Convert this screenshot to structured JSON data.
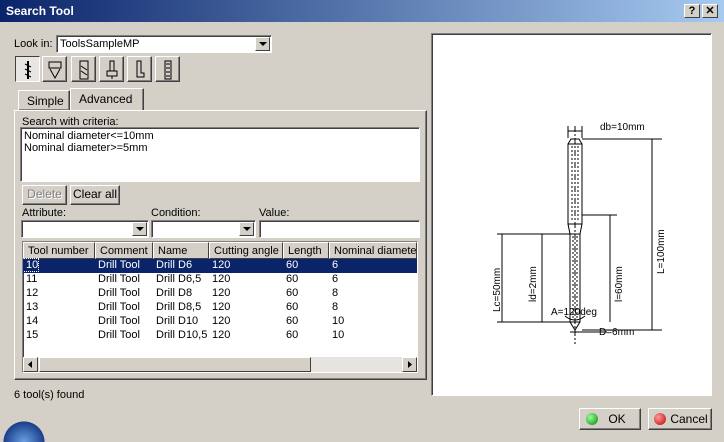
{
  "window": {
    "title": "Search Tool",
    "help_label": "?",
    "close_label": "✕"
  },
  "look_in": {
    "label": "Look in:",
    "value": "ToolsSampleMP"
  },
  "tool_types": [
    "drill-icon",
    "countersink-icon",
    "end-mill-icon",
    "t-slotter-icon",
    "boring-bar-icon",
    "tap-icon"
  ],
  "tabs": [
    {
      "label": "Simple"
    },
    {
      "label": "Advanced"
    }
  ],
  "criteria": {
    "label": "Search with criteria:",
    "lines": [
      "Nominal diameter<=10mm",
      "Nominal diameter>=5mm"
    ]
  },
  "buttons": {
    "delete": "Delete",
    "clear_all": "Clear all",
    "ok": "OK",
    "cancel": "Cancel"
  },
  "filters": {
    "attribute_label": "Attribute:",
    "condition_label": "Condition:",
    "value_label": "Value:",
    "attribute_value": "",
    "condition_value": "",
    "value_value": ""
  },
  "results": {
    "columns": [
      "Tool number",
      "Comment",
      "Name",
      "Cutting angle",
      "Length",
      "Nominal diameter"
    ],
    "rows": [
      [
        "10",
        "Drill Tool",
        "Drill D6",
        "120",
        "60",
        "6"
      ],
      [
        "11",
        "Drill Tool",
        "Drill D6,5",
        "120",
        "60",
        "6"
      ],
      [
        "12",
        "Drill Tool",
        "Drill D8",
        "120",
        "60",
        "8"
      ],
      [
        "13",
        "Drill Tool",
        "Drill D8,5",
        "120",
        "60",
        "8"
      ],
      [
        "14",
        "Drill Tool",
        "Drill D10",
        "120",
        "60",
        "10"
      ],
      [
        "15",
        "Drill Tool",
        "Drill D10,5",
        "120",
        "60",
        "10"
      ]
    ],
    "selected_row": 0
  },
  "status": "6 tool(s) found",
  "preview": {
    "labels": {
      "db": "db=10mm",
      "L": "L=100mm",
      "Lc": "Lc=50mm",
      "ld": "ld=2mm",
      "l": "l=60mm",
      "A": "A=120deg",
      "D": "D=6mm"
    }
  },
  "colors": {
    "title_start": "#0a246a",
    "title_end": "#a6caf0",
    "selection": "#0a246a",
    "face": "#d4d0c8"
  }
}
